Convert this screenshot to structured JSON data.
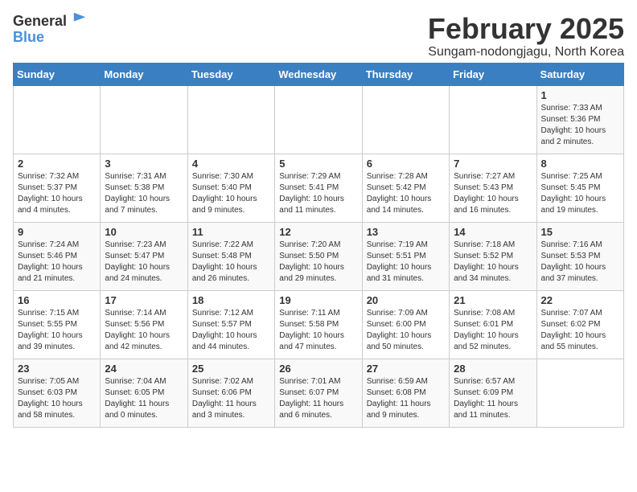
{
  "header": {
    "logo_general": "General",
    "logo_blue": "Blue",
    "title": "February 2025",
    "subtitle": "Sungam-nodongjagu, North Korea"
  },
  "days_of_week": [
    "Sunday",
    "Monday",
    "Tuesday",
    "Wednesday",
    "Thursday",
    "Friday",
    "Saturday"
  ],
  "weeks": [
    [
      {
        "day": "",
        "info": ""
      },
      {
        "day": "",
        "info": ""
      },
      {
        "day": "",
        "info": ""
      },
      {
        "day": "",
        "info": ""
      },
      {
        "day": "",
        "info": ""
      },
      {
        "day": "",
        "info": ""
      },
      {
        "day": "1",
        "info": "Sunrise: 7:33 AM\nSunset: 5:36 PM\nDaylight: 10 hours\nand 2 minutes."
      }
    ],
    [
      {
        "day": "2",
        "info": "Sunrise: 7:32 AM\nSunset: 5:37 PM\nDaylight: 10 hours\nand 4 minutes."
      },
      {
        "day": "3",
        "info": "Sunrise: 7:31 AM\nSunset: 5:38 PM\nDaylight: 10 hours\nand 7 minutes."
      },
      {
        "day": "4",
        "info": "Sunrise: 7:30 AM\nSunset: 5:40 PM\nDaylight: 10 hours\nand 9 minutes."
      },
      {
        "day": "5",
        "info": "Sunrise: 7:29 AM\nSunset: 5:41 PM\nDaylight: 10 hours\nand 11 minutes."
      },
      {
        "day": "6",
        "info": "Sunrise: 7:28 AM\nSunset: 5:42 PM\nDaylight: 10 hours\nand 14 minutes."
      },
      {
        "day": "7",
        "info": "Sunrise: 7:27 AM\nSunset: 5:43 PM\nDaylight: 10 hours\nand 16 minutes."
      },
      {
        "day": "8",
        "info": "Sunrise: 7:25 AM\nSunset: 5:45 PM\nDaylight: 10 hours\nand 19 minutes."
      }
    ],
    [
      {
        "day": "9",
        "info": "Sunrise: 7:24 AM\nSunset: 5:46 PM\nDaylight: 10 hours\nand 21 minutes."
      },
      {
        "day": "10",
        "info": "Sunrise: 7:23 AM\nSunset: 5:47 PM\nDaylight: 10 hours\nand 24 minutes."
      },
      {
        "day": "11",
        "info": "Sunrise: 7:22 AM\nSunset: 5:48 PM\nDaylight: 10 hours\nand 26 minutes."
      },
      {
        "day": "12",
        "info": "Sunrise: 7:20 AM\nSunset: 5:50 PM\nDaylight: 10 hours\nand 29 minutes."
      },
      {
        "day": "13",
        "info": "Sunrise: 7:19 AM\nSunset: 5:51 PM\nDaylight: 10 hours\nand 31 minutes."
      },
      {
        "day": "14",
        "info": "Sunrise: 7:18 AM\nSunset: 5:52 PM\nDaylight: 10 hours\nand 34 minutes."
      },
      {
        "day": "15",
        "info": "Sunrise: 7:16 AM\nSunset: 5:53 PM\nDaylight: 10 hours\nand 37 minutes."
      }
    ],
    [
      {
        "day": "16",
        "info": "Sunrise: 7:15 AM\nSunset: 5:55 PM\nDaylight: 10 hours\nand 39 minutes."
      },
      {
        "day": "17",
        "info": "Sunrise: 7:14 AM\nSunset: 5:56 PM\nDaylight: 10 hours\nand 42 minutes."
      },
      {
        "day": "18",
        "info": "Sunrise: 7:12 AM\nSunset: 5:57 PM\nDaylight: 10 hours\nand 44 minutes."
      },
      {
        "day": "19",
        "info": "Sunrise: 7:11 AM\nSunset: 5:58 PM\nDaylight: 10 hours\nand 47 minutes."
      },
      {
        "day": "20",
        "info": "Sunrise: 7:09 AM\nSunset: 6:00 PM\nDaylight: 10 hours\nand 50 minutes."
      },
      {
        "day": "21",
        "info": "Sunrise: 7:08 AM\nSunset: 6:01 PM\nDaylight: 10 hours\nand 52 minutes."
      },
      {
        "day": "22",
        "info": "Sunrise: 7:07 AM\nSunset: 6:02 PM\nDaylight: 10 hours\nand 55 minutes."
      }
    ],
    [
      {
        "day": "23",
        "info": "Sunrise: 7:05 AM\nSunset: 6:03 PM\nDaylight: 10 hours\nand 58 minutes."
      },
      {
        "day": "24",
        "info": "Sunrise: 7:04 AM\nSunset: 6:05 PM\nDaylight: 11 hours\nand 0 minutes."
      },
      {
        "day": "25",
        "info": "Sunrise: 7:02 AM\nSunset: 6:06 PM\nDaylight: 11 hours\nand 3 minutes."
      },
      {
        "day": "26",
        "info": "Sunrise: 7:01 AM\nSunset: 6:07 PM\nDaylight: 11 hours\nand 6 minutes."
      },
      {
        "day": "27",
        "info": "Sunrise: 6:59 AM\nSunset: 6:08 PM\nDaylight: 11 hours\nand 9 minutes."
      },
      {
        "day": "28",
        "info": "Sunrise: 6:57 AM\nSunset: 6:09 PM\nDaylight: 11 hours\nand 11 minutes."
      },
      {
        "day": "",
        "info": ""
      }
    ]
  ]
}
